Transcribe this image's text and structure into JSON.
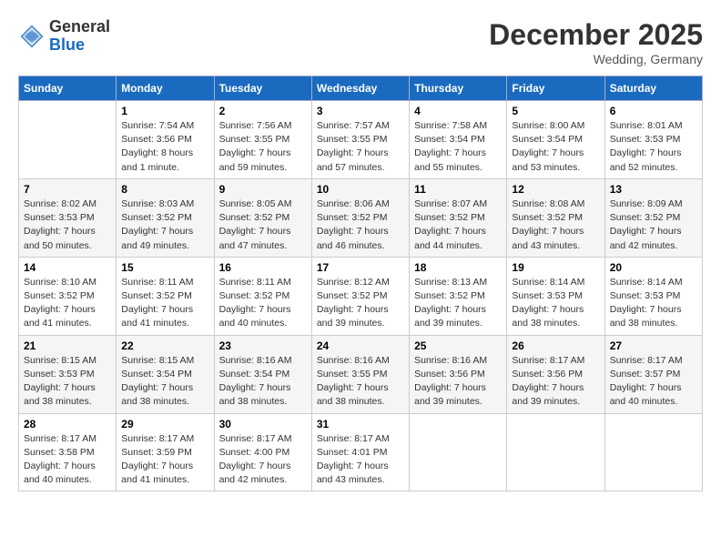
{
  "header": {
    "logo_general": "General",
    "logo_blue": "Blue",
    "month_title": "December 2025",
    "location": "Wedding, Germany"
  },
  "days_of_week": [
    "Sunday",
    "Monday",
    "Tuesday",
    "Wednesday",
    "Thursday",
    "Friday",
    "Saturday"
  ],
  "weeks": [
    [
      {
        "day": "",
        "info": ""
      },
      {
        "day": "1",
        "info": "Sunrise: 7:54 AM\nSunset: 3:56 PM\nDaylight: 8 hours\nand 1 minute."
      },
      {
        "day": "2",
        "info": "Sunrise: 7:56 AM\nSunset: 3:55 PM\nDaylight: 7 hours\nand 59 minutes."
      },
      {
        "day": "3",
        "info": "Sunrise: 7:57 AM\nSunset: 3:55 PM\nDaylight: 7 hours\nand 57 minutes."
      },
      {
        "day": "4",
        "info": "Sunrise: 7:58 AM\nSunset: 3:54 PM\nDaylight: 7 hours\nand 55 minutes."
      },
      {
        "day": "5",
        "info": "Sunrise: 8:00 AM\nSunset: 3:54 PM\nDaylight: 7 hours\nand 53 minutes."
      },
      {
        "day": "6",
        "info": "Sunrise: 8:01 AM\nSunset: 3:53 PM\nDaylight: 7 hours\nand 52 minutes."
      }
    ],
    [
      {
        "day": "7",
        "info": "Sunrise: 8:02 AM\nSunset: 3:53 PM\nDaylight: 7 hours\nand 50 minutes."
      },
      {
        "day": "8",
        "info": "Sunrise: 8:03 AM\nSunset: 3:52 PM\nDaylight: 7 hours\nand 49 minutes."
      },
      {
        "day": "9",
        "info": "Sunrise: 8:05 AM\nSunset: 3:52 PM\nDaylight: 7 hours\nand 47 minutes."
      },
      {
        "day": "10",
        "info": "Sunrise: 8:06 AM\nSunset: 3:52 PM\nDaylight: 7 hours\nand 46 minutes."
      },
      {
        "day": "11",
        "info": "Sunrise: 8:07 AM\nSunset: 3:52 PM\nDaylight: 7 hours\nand 44 minutes."
      },
      {
        "day": "12",
        "info": "Sunrise: 8:08 AM\nSunset: 3:52 PM\nDaylight: 7 hours\nand 43 minutes."
      },
      {
        "day": "13",
        "info": "Sunrise: 8:09 AM\nSunset: 3:52 PM\nDaylight: 7 hours\nand 42 minutes."
      }
    ],
    [
      {
        "day": "14",
        "info": "Sunrise: 8:10 AM\nSunset: 3:52 PM\nDaylight: 7 hours\nand 41 minutes."
      },
      {
        "day": "15",
        "info": "Sunrise: 8:11 AM\nSunset: 3:52 PM\nDaylight: 7 hours\nand 41 minutes."
      },
      {
        "day": "16",
        "info": "Sunrise: 8:11 AM\nSunset: 3:52 PM\nDaylight: 7 hours\nand 40 minutes."
      },
      {
        "day": "17",
        "info": "Sunrise: 8:12 AM\nSunset: 3:52 PM\nDaylight: 7 hours\nand 39 minutes."
      },
      {
        "day": "18",
        "info": "Sunrise: 8:13 AM\nSunset: 3:52 PM\nDaylight: 7 hours\nand 39 minutes."
      },
      {
        "day": "19",
        "info": "Sunrise: 8:14 AM\nSunset: 3:53 PM\nDaylight: 7 hours\nand 38 minutes."
      },
      {
        "day": "20",
        "info": "Sunrise: 8:14 AM\nSunset: 3:53 PM\nDaylight: 7 hours\nand 38 minutes."
      }
    ],
    [
      {
        "day": "21",
        "info": "Sunrise: 8:15 AM\nSunset: 3:53 PM\nDaylight: 7 hours\nand 38 minutes."
      },
      {
        "day": "22",
        "info": "Sunrise: 8:15 AM\nSunset: 3:54 PM\nDaylight: 7 hours\nand 38 minutes."
      },
      {
        "day": "23",
        "info": "Sunrise: 8:16 AM\nSunset: 3:54 PM\nDaylight: 7 hours\nand 38 minutes."
      },
      {
        "day": "24",
        "info": "Sunrise: 8:16 AM\nSunset: 3:55 PM\nDaylight: 7 hours\nand 38 minutes."
      },
      {
        "day": "25",
        "info": "Sunrise: 8:16 AM\nSunset: 3:56 PM\nDaylight: 7 hours\nand 39 minutes."
      },
      {
        "day": "26",
        "info": "Sunrise: 8:17 AM\nSunset: 3:56 PM\nDaylight: 7 hours\nand 39 minutes."
      },
      {
        "day": "27",
        "info": "Sunrise: 8:17 AM\nSunset: 3:57 PM\nDaylight: 7 hours\nand 40 minutes."
      }
    ],
    [
      {
        "day": "28",
        "info": "Sunrise: 8:17 AM\nSunset: 3:58 PM\nDaylight: 7 hours\nand 40 minutes."
      },
      {
        "day": "29",
        "info": "Sunrise: 8:17 AM\nSunset: 3:59 PM\nDaylight: 7 hours\nand 41 minutes."
      },
      {
        "day": "30",
        "info": "Sunrise: 8:17 AM\nSunset: 4:00 PM\nDaylight: 7 hours\nand 42 minutes."
      },
      {
        "day": "31",
        "info": "Sunrise: 8:17 AM\nSunset: 4:01 PM\nDaylight: 7 hours\nand 43 minutes."
      },
      {
        "day": "",
        "info": ""
      },
      {
        "day": "",
        "info": ""
      },
      {
        "day": "",
        "info": ""
      }
    ]
  ]
}
